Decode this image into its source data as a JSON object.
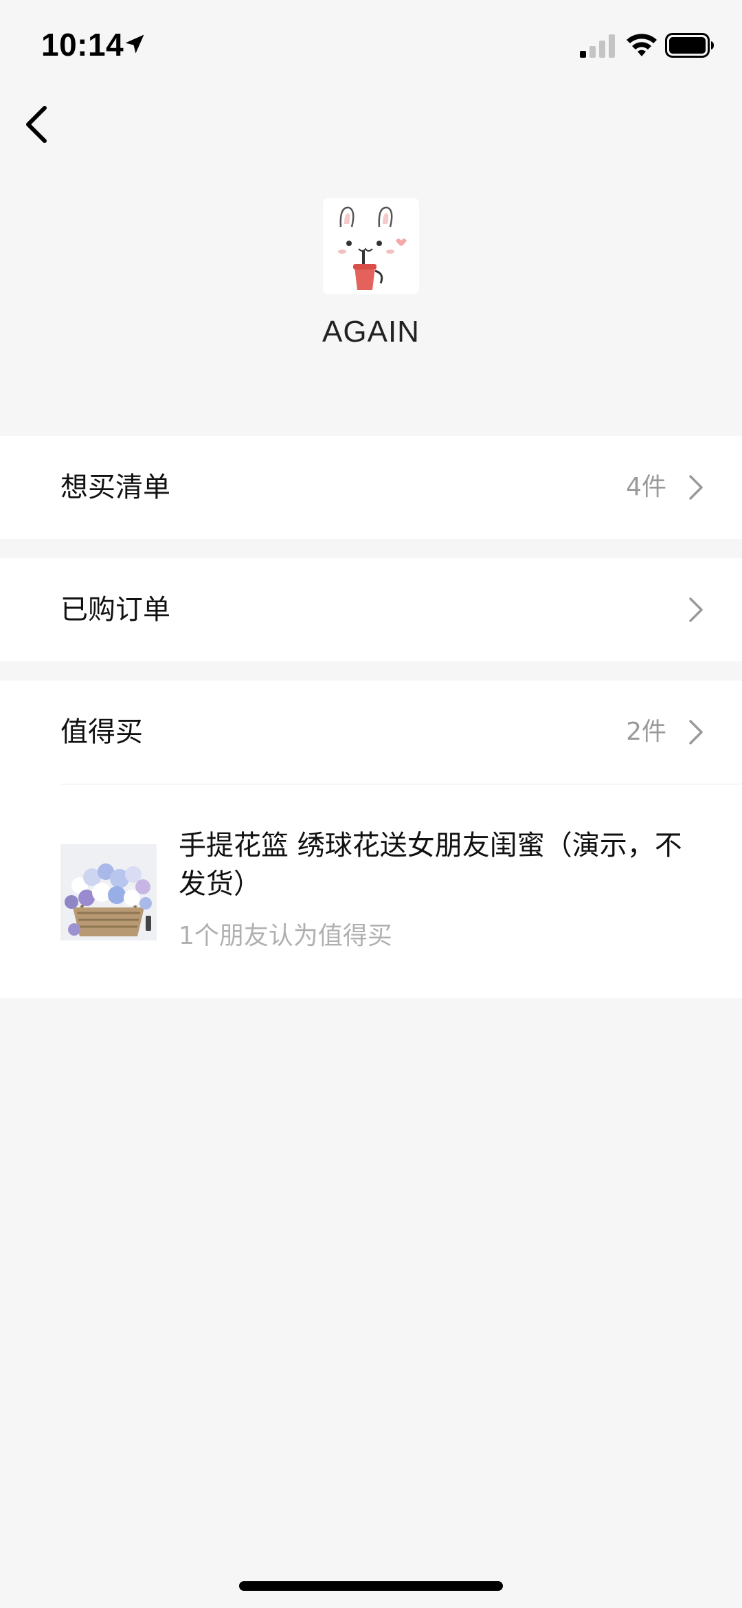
{
  "status_bar": {
    "time": "10:14",
    "icons": [
      "location-arrow-icon",
      "cellular-signal-icon",
      "wifi-icon",
      "battery-icon"
    ]
  },
  "nav": {
    "back_icon": "chevron-left-icon"
  },
  "profile": {
    "avatar_icon": "bunny-drink-avatar",
    "name": "AGAIN"
  },
  "menu": {
    "wishlist": {
      "label": "想买清单",
      "count": "4件"
    },
    "orders": {
      "label": "已购订单"
    },
    "worth_buying": {
      "label": "值得买",
      "count": "2件"
    }
  },
  "product": {
    "title": "手提花篮 绣球花送女朋友闺蜜（演示，不发货）",
    "subtitle": "1个朋友认为值得买",
    "image_icon": "flower-basket-thumbnail"
  },
  "colors": {
    "background": "#f6f6f6",
    "card": "#ffffff",
    "secondary_text": "#9a9a9a"
  }
}
